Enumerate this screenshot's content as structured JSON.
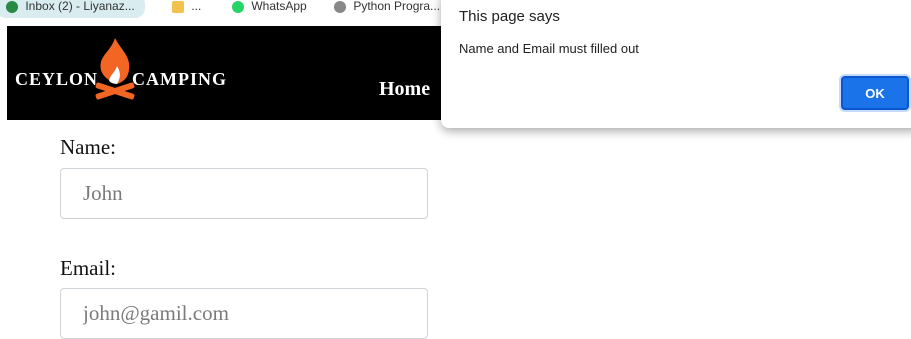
{
  "bookmarks": [
    {
      "label": "Inbox (2) - Liyanaz..."
    },
    {
      "label": "..."
    },
    {
      "label": "WhatsApp"
    },
    {
      "label": "Python Progra..."
    }
  ],
  "header": {
    "brand_left": "CEYLON",
    "brand_right": "CAMPING",
    "nav_home": "Home",
    "colors": {
      "background": "#000000",
      "flame": "#f26522",
      "text": "#ffffff"
    }
  },
  "form": {
    "name_label": "Name:",
    "name_placeholder": "John",
    "email_label": "Email:",
    "email_placeholder": "john@gamil.com"
  },
  "dialog": {
    "title": "This page says",
    "message": "Name and Email must filled out",
    "ok_label": "OK",
    "accent": "#1a73e8"
  }
}
